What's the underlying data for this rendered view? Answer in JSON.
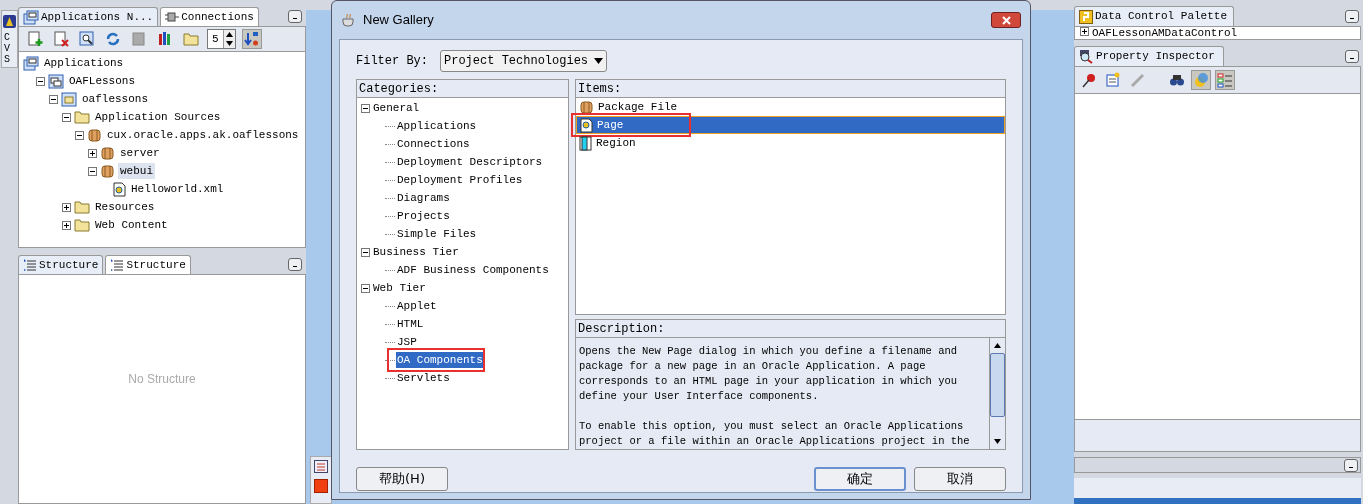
{
  "side_tab": {
    "label": "CVS"
  },
  "navigator": {
    "tabs": [
      {
        "label": "Applications N...",
        "selected": true
      },
      {
        "label": "Connections",
        "selected": false
      }
    ],
    "spinner_value": "5",
    "tree": [
      {
        "label": "Applications",
        "kind": "apps",
        "children": [
          {
            "label": "OAFLessons",
            "kind": "app",
            "expanded": true,
            "children": [
              {
                "label": "oaflessons",
                "kind": "project",
                "expanded": true,
                "children": [
                  {
                    "label": "Application Sources",
                    "kind": "folder",
                    "expanded": true,
                    "children": [
                      {
                        "label": "cux.oracle.apps.ak.oaflessons",
                        "kind": "package",
                        "expanded": true,
                        "children": [
                          {
                            "label": "server",
                            "kind": "package",
                            "expanded": false,
                            "selected": false
                          },
                          {
                            "label": "webui",
                            "kind": "package",
                            "expanded": true,
                            "selected": true,
                            "children": [
                              {
                                "label": "Helloworld.xml",
                                "kind": "file"
                              }
                            ]
                          }
                        ]
                      }
                    ]
                  },
                  {
                    "label": "Resources",
                    "kind": "folder",
                    "expanded": false
                  },
                  {
                    "label": "Web Content",
                    "kind": "folder",
                    "expanded": false
                  }
                ]
              }
            ]
          }
        ]
      }
    ]
  },
  "structure": {
    "tabs": [
      {
        "label": "Structure",
        "selected": true
      },
      {
        "label": "Structure",
        "selected": false
      }
    ],
    "empty_text": "No Structure"
  },
  "dialog": {
    "title": "New Gallery",
    "filter_label": "Filter By:",
    "filter_value": "Project Technologies",
    "categories_label": "Categories:",
    "categories": [
      {
        "label": "General",
        "expanded": true,
        "children": [
          {
            "label": "Applications",
            "selected": false
          },
          {
            "label": "Connections",
            "selected": false
          },
          {
            "label": "Deployment Descriptors",
            "selected": false
          },
          {
            "label": "Deployment Profiles",
            "selected": false
          },
          {
            "label": "Diagrams",
            "selected": false
          },
          {
            "label": "Projects",
            "selected": false
          },
          {
            "label": "Simple Files",
            "selected": false
          }
        ]
      },
      {
        "label": "Business Tier",
        "expanded": true,
        "children": [
          {
            "label": "ADF Business Components",
            "selected": false
          }
        ]
      },
      {
        "label": "Web Tier",
        "expanded": true,
        "children": [
          {
            "label": "Applet",
            "selected": false
          },
          {
            "label": "HTML",
            "selected": false
          },
          {
            "label": "JSP",
            "selected": false
          },
          {
            "label": "OA Components",
            "selected": true
          },
          {
            "label": "Servlets",
            "selected": false
          }
        ]
      }
    ],
    "items_label": "Items:",
    "items": [
      {
        "label": "Package File",
        "kind": "package",
        "selected": false
      },
      {
        "label": "Page",
        "kind": "page",
        "selected": true
      },
      {
        "label": "Region",
        "kind": "region",
        "selected": false
      }
    ],
    "description_label": "Description:",
    "description": [
      "Opens the New Page dialog in which you define a filename and package for a new page in an Oracle Application. A page corresponds to an HTML page in your application in which you define your User Interface components.",
      "To enable this option, you must select an Oracle Applications project or a file within an Oracle Applications project in the"
    ],
    "buttons": {
      "help": "帮助(H)",
      "ok": "确定",
      "cancel": "取消"
    }
  },
  "data_palette": {
    "title": "Data Control Palette",
    "item": "OAFLessonAMDataControl"
  },
  "inspector": {
    "title": "Property Inspector"
  }
}
